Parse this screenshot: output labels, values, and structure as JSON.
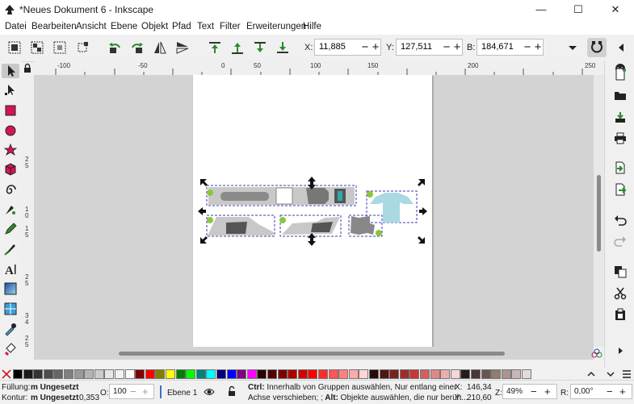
{
  "window": {
    "title": "*Neues Dokument 6 - Inkscape",
    "minimize": "—",
    "maximize": "☐",
    "close": "✕"
  },
  "menu": [
    "Datei",
    "Bearbeiten",
    "Ansicht",
    "Ebene",
    "Objekt",
    "Pfad",
    "Text",
    "Filter",
    "Erweiterungen",
    "Hilfe"
  ],
  "toolbar": {
    "x_label": "X:",
    "x_value": "11,885",
    "y_label": "Y:",
    "y_value": "127,511",
    "w_label": "B:",
    "w_value": "184,671",
    "minus": "−",
    "plus": "+"
  },
  "hruler": {
    "labels": [
      "-100",
      "-50",
      "0",
      "50",
      "100",
      "150",
      "200",
      "250"
    ]
  },
  "vruler": {
    "labels": [
      "2",
      "5",
      "1",
      "0",
      "1",
      "5",
      "2",
      "5",
      "3",
      "4",
      "2",
      "5"
    ]
  },
  "palette": {
    "colors": [
      "#000000",
      "#1a1a1a",
      "#333333",
      "#4d4d4d",
      "#666666",
      "#808080",
      "#999999",
      "#b3b3b3",
      "#cccccc",
      "#e6e6e6",
      "#f2f2f2",
      "#ffffff",
      "#800000",
      "#ff0000",
      "#808000",
      "#ffff00",
      "#008000",
      "#00ff00",
      "#008080",
      "#00ffff",
      "#000080",
      "#0000ff",
      "#800080",
      "#ff00ff",
      "#2b0000",
      "#550000",
      "#800000",
      "#aa0000",
      "#d40000",
      "#ff0000",
      "#ff2a2a",
      "#ff5555",
      "#ff8080",
      "#ffaaaa",
      "#ffd5d5",
      "#280b0b",
      "#501616",
      "#782121",
      "#a02c2c",
      "#c83737",
      "#d35f5f",
      "#de8787",
      "#e9afaf",
      "#f4d7d7",
      "#241c1c",
      "#483737",
      "#6c5353",
      "#917c6f",
      "#ac9393",
      "#c8b7b7",
      "#e3dbdb"
    ]
  },
  "status": {
    "fill_label": "Füllung:",
    "fill_value": "m Ungesetzt",
    "stroke_label": "Kontur:",
    "stroke_value": "m Ungesetzt",
    "stroke_width": "0,353",
    "opacity_label": "O:",
    "opacity_value": "100",
    "layer": "Ebene 1",
    "msg_ctrl": "Ctrl:",
    "msg_line1": " Innerhalb von Gruppen auswählen, Nur entlang einer",
    "msg_line2": "Achse verschieben; ;",
    "msg_alt": " Alt:",
    "msg_line2b": " Objekte auswählen, die nur berüh...",
    "x_label": "X:",
    "x_value": "146,34",
    "y_label": "Y:",
    "y_value": "210,60",
    "zoom_label": "Z:",
    "zoom_value": "49%",
    "rot_label": "R:",
    "rot_value": "0,00°"
  }
}
